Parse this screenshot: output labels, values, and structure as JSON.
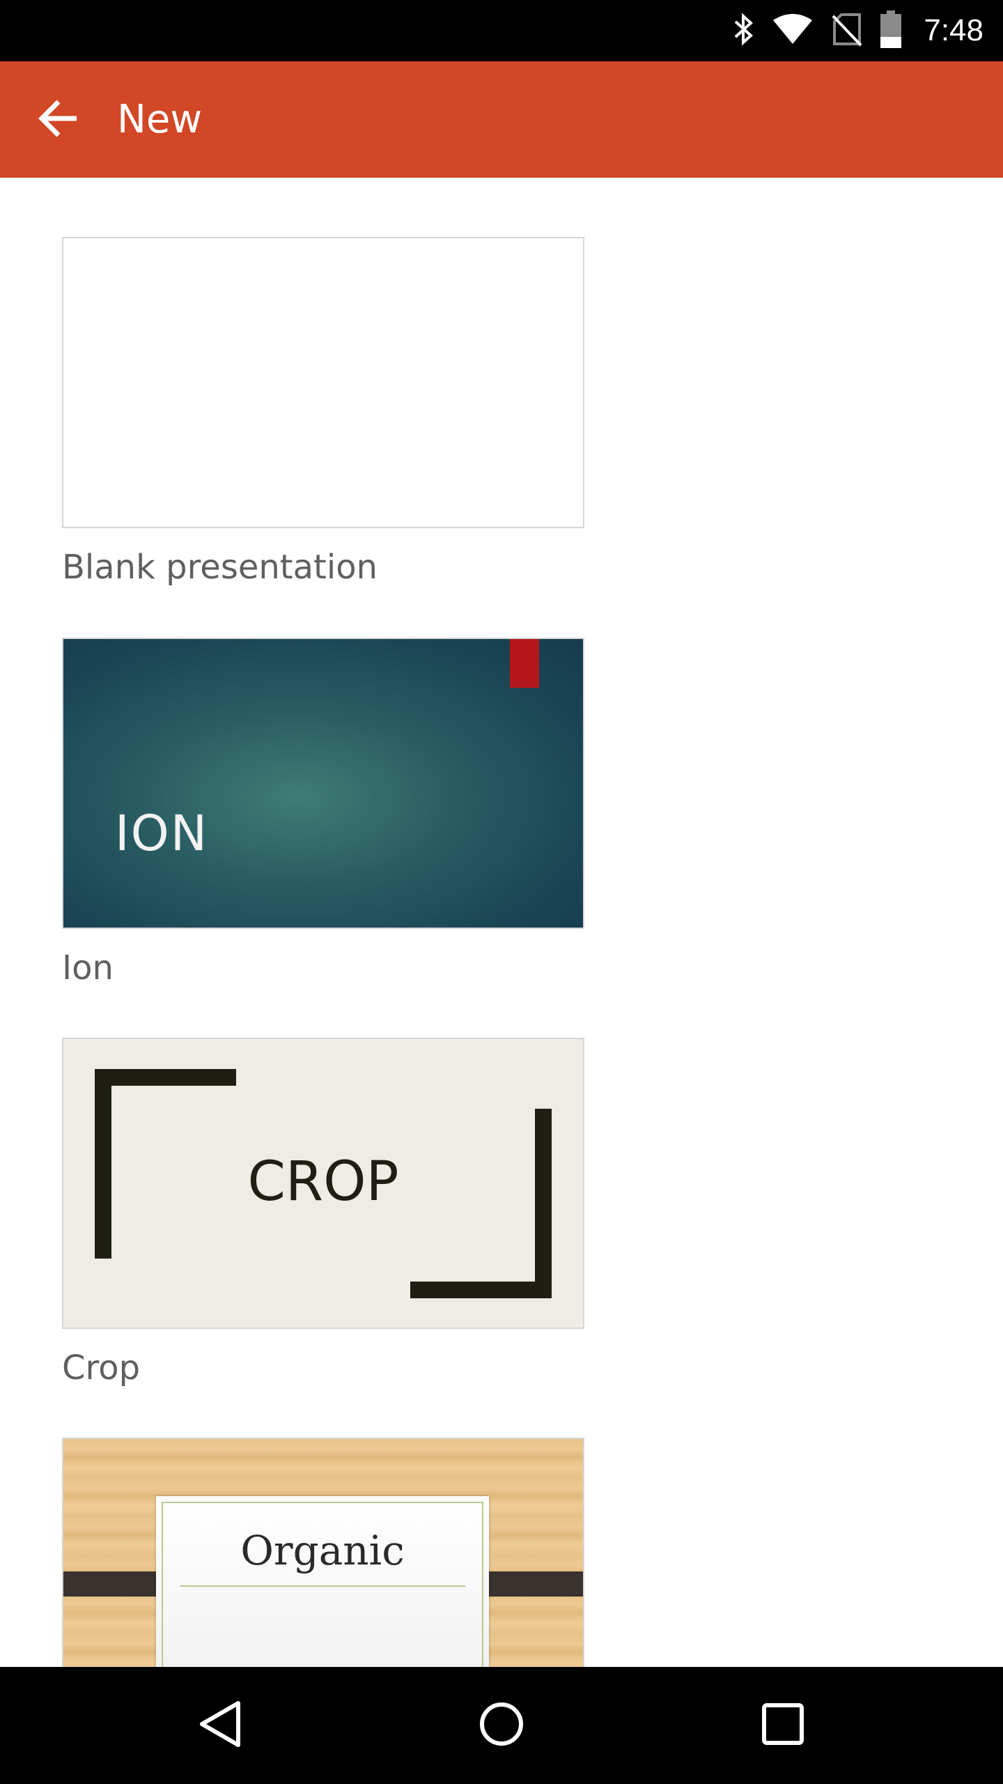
{
  "status_bar": {
    "time": "7:48",
    "icons": [
      "bluetooth-icon",
      "wifi-icon",
      "no-sim-icon",
      "battery-icon"
    ]
  },
  "app_bar": {
    "title": "New",
    "back_icon": "arrow-left-icon",
    "color": "#d24726"
  },
  "templates": [
    {
      "label": "Blank presentation",
      "thumbnail_text": ""
    },
    {
      "label": "Ion",
      "thumbnail_text": "ION"
    },
    {
      "label": "Crop",
      "thumbnail_text": "CROP"
    },
    {
      "label": "Organic",
      "thumbnail_text": "Organic"
    }
  ],
  "nav_bar": {
    "buttons": [
      "back-triangle-icon",
      "home-circle-icon",
      "recents-square-icon"
    ]
  }
}
